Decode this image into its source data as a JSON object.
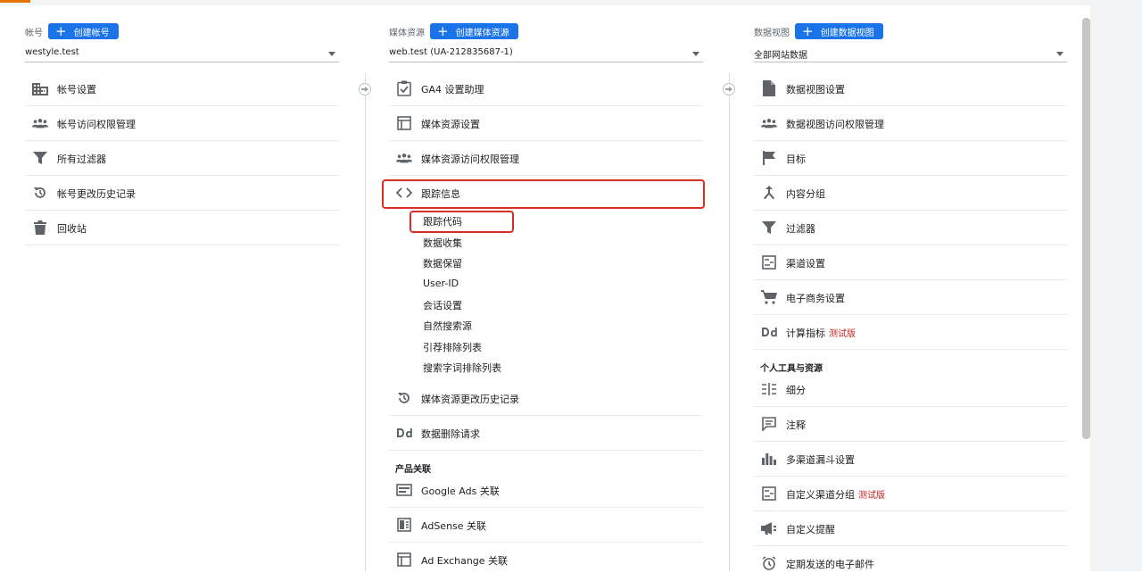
{
  "account": {
    "title": "帐号",
    "create_label": "创建帐号",
    "selected": "westyle.test",
    "items": [
      {
        "label": "帐号设置"
      },
      {
        "label": "帐号访问权限管理"
      },
      {
        "label": "所有过滤器"
      },
      {
        "label": "帐号更改历史记录"
      },
      {
        "label": "回收站"
      }
    ]
  },
  "property": {
    "title": "媒体资源",
    "create_label": "创建媒体资源",
    "selected": "web.test (UA-212835687-1)",
    "items": [
      {
        "label": "GA4 设置助理"
      },
      {
        "label": "媒体资源设置"
      },
      {
        "label": "媒体资源访问权限管理"
      },
      {
        "label": "跟踪信息"
      }
    ],
    "tracking_sub": [
      "跟踪代码",
      "数据收集",
      "数据保留",
      "User-ID",
      "会话设置",
      "自然搜索源",
      "引荐排除列表",
      "搜索字词排除列表"
    ],
    "more_items": [
      {
        "label": "媒体资源更改历史记录"
      },
      {
        "label": "数据删除请求"
      }
    ],
    "product_link_title": "产品关联",
    "links": [
      {
        "label": "Google Ads 关联"
      },
      {
        "label": "AdSense 关联"
      },
      {
        "label": "Ad Exchange 关联"
      }
    ]
  },
  "view": {
    "title": "数据视图",
    "create_label": "创建数据视图",
    "selected": "全部网站数据",
    "items": [
      {
        "label": "数据视图设置"
      },
      {
        "label": "数据视图访问权限管理"
      },
      {
        "label": "目标"
      },
      {
        "label": "内容分组"
      },
      {
        "label": "过滤器"
      },
      {
        "label": "渠道设置"
      },
      {
        "label": "电子商务设置"
      },
      {
        "label": "计算指标",
        "beta": "测试版"
      }
    ],
    "personal_title": "个人工具与资源",
    "personal_items": [
      {
        "label": "细分"
      },
      {
        "label": "注释"
      },
      {
        "label": "多渠道漏斗设置"
      },
      {
        "label": "自定义渠道分组",
        "beta": "测试版"
      },
      {
        "label": "自定义提醒"
      },
      {
        "label": "定期发送的电子邮件"
      }
    ]
  },
  "colors": {
    "accent": "#1a73e8",
    "highlight": "#d93025",
    "beta": "#c5221f",
    "icon": "#5f6368"
  }
}
